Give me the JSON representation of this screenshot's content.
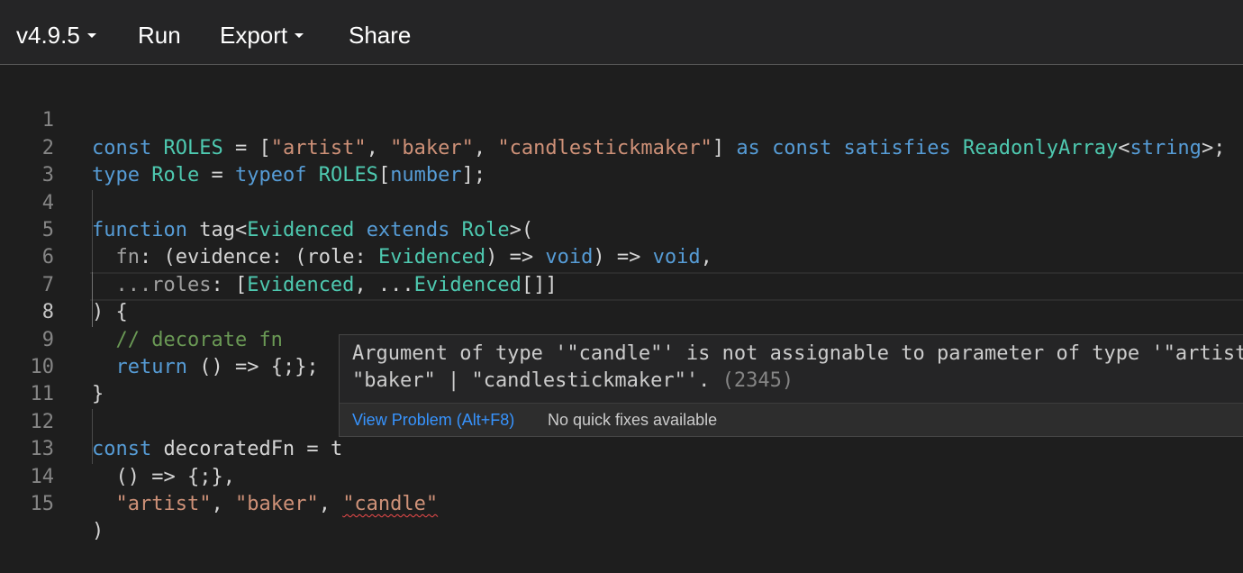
{
  "toolbar": {
    "version_label": "v4.9.5",
    "run_label": "Run",
    "export_label": "Export",
    "share_label": "Share"
  },
  "editor": {
    "line_numbers": [
      "1",
      "2",
      "3",
      "4",
      "5",
      "6",
      "7",
      "8",
      "9",
      "10",
      "11",
      "12",
      "13",
      "14",
      "15"
    ],
    "active_line": "8",
    "lines": {
      "l1": [
        "const",
        " ",
        "ROLES",
        " = [",
        "\"artist\"",
        ", ",
        "\"baker\"",
        ", ",
        "\"candlestickmaker\"",
        "] ",
        "as",
        " ",
        "const",
        " ",
        "satisfies",
        " ",
        "ReadonlyArray",
        "<",
        "string",
        ">;"
      ],
      "l2": [
        "type",
        " ",
        "Role",
        " = ",
        "typeof",
        " ",
        "ROLES",
        "[",
        "number",
        "];"
      ],
      "l4": [
        "function",
        " ",
        "tag",
        "<",
        "Evidenced",
        " ",
        "extends",
        " ",
        "Role",
        ">("
      ],
      "l5": [
        "  ",
        "fn",
        ": (",
        "evidence",
        ": (",
        "role",
        ": ",
        "Evidenced",
        ") => ",
        "void",
        ") => ",
        "void",
        ","
      ],
      "l6": [
        "  ",
        "...roles",
        ": [",
        "Evidenced",
        ", ...",
        "Evidenced",
        "[]]"
      ],
      "l7": [
        ") {"
      ],
      "l8": [
        "  ",
        "// decorate fn"
      ],
      "l9": [
        "  ",
        "return",
        " () => {;};"
      ],
      "l10": [
        "}"
      ],
      "l12": [
        "const",
        " ",
        "decoratedFn",
        " = ",
        "t"
      ],
      "l13": [
        "  () => {;},"
      ],
      "l14": [
        "  ",
        "\"artist\"",
        ", ",
        "\"baker\"",
        ", ",
        "\"candle\""
      ],
      "l15": [
        ")"
      ]
    }
  },
  "hover": {
    "message_line1": "Argument of type '\"candle\"' is not assignable to parameter of type '\"artist\" |",
    "message_line2": "\"baker\" | \"candlestickmaker\"'. ",
    "error_code": "(2345)",
    "view_problem_label": "View Problem (Alt+F8)",
    "no_fixes_label": "No quick fixes available"
  },
  "colors": {
    "keyword": "#569cd6",
    "type": "#4ec9b0",
    "string": "#ce9178",
    "identifier": "#9cdcfe",
    "comment": "#6a9955",
    "link": "#3794ff",
    "error_squiggle": "#f14c4c"
  },
  "icons": {
    "version_dropdown": "chevron-down-icon",
    "export_dropdown": "chevron-down-icon"
  }
}
